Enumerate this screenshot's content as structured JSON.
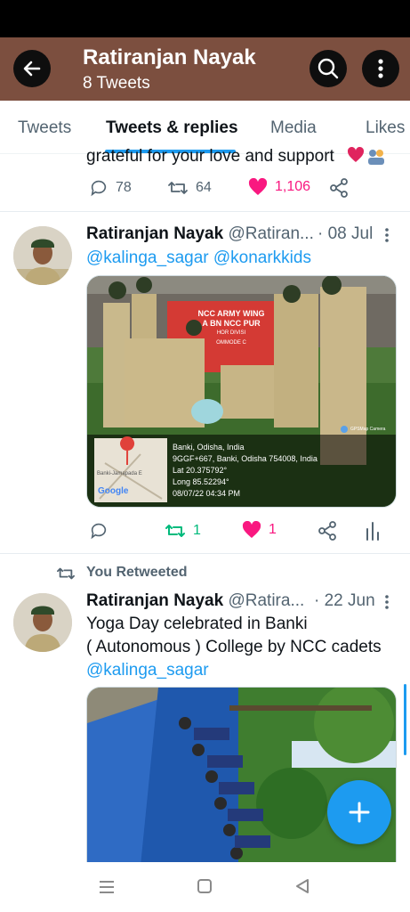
{
  "header": {
    "title": "Ratiranjan Nayak",
    "subtitle": "8 Tweets",
    "bar_color": "#7c4f3f"
  },
  "tabs": [
    {
      "label": "Tweets",
      "active": false
    },
    {
      "label": "Tweets & replies",
      "active": true
    },
    {
      "label": "Media",
      "active": false
    },
    {
      "label": "Likes",
      "active": false
    }
  ],
  "tweet0": {
    "text": "grateful for your love and support",
    "replies": "78",
    "retweets": "64",
    "likes": "1,106"
  },
  "tweet1": {
    "name": "Ratiranjan Nayak",
    "handle": "@Ratiran...",
    "date": "· 08 Jul",
    "mentions": "@kalinga_sagar @konarkkids",
    "retweets": "1",
    "likes": "1",
    "image": {
      "banner_title": "NCC ARMY WING",
      "banner_sub": "A BN NCC PUR",
      "banner_line3": "HOR DIVISI",
      "banner_line4": "OMMODE C",
      "stamp_app": "GPSMap Camera",
      "location": "Banki, Odisha, India",
      "address": "9GGF+667, Banki, Odisha 754008, India",
      "lat": "Lat 20.375792°",
      "long": "Long 85.52294°",
      "datetime": "08/07/22 04:34 PM",
      "map_label": "Google",
      "map_place": "Banki-Jamapada E"
    }
  },
  "tweet2": {
    "retweeted_label": "You Retweeted",
    "name": "Ratiranjan Nayak",
    "handle": "@Ratira...",
    "date": "· 22 Jun",
    "text_line1": "Yoga Day celebrated in Banki",
    "text_line2": "( Autonomous ) College by NCC cadets",
    "mention": "@kalinga_sagar"
  },
  "colors": {
    "accent": "#1d9bf0",
    "like": "#f91880",
    "retweet": "#00ba7c"
  }
}
